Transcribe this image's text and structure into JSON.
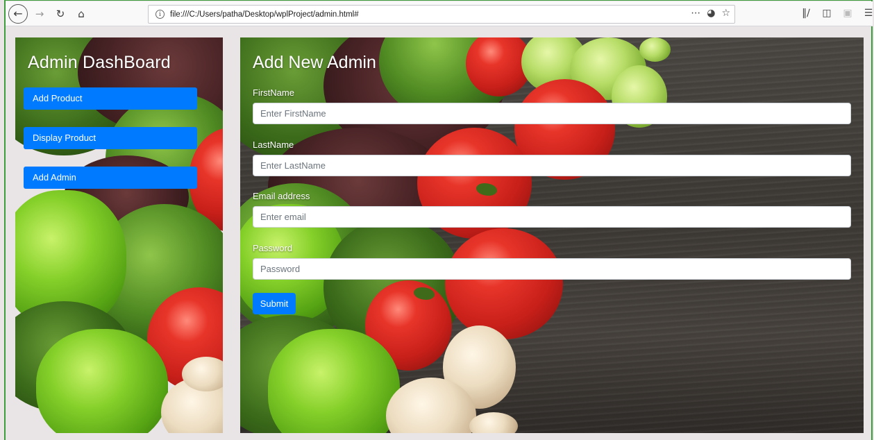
{
  "browser": {
    "url": "file:///C:/Users/patha/Desktop/wplProject/admin.html#",
    "icons": {
      "back": "back-arrow-icon",
      "forward": "forward-arrow-icon",
      "reload": "reload-icon",
      "home": "home-icon",
      "info": "info-icon",
      "page_actions": "more-dots-icon",
      "pocket": "pocket-icon",
      "bookmark": "star-icon",
      "library": "library-icon",
      "sidebar": "sidebar-icon",
      "reader": "reader-icon",
      "menu": "hamburger-menu-icon"
    }
  },
  "sidebar": {
    "title": "Admin DashBoard",
    "items": [
      {
        "label": "Add Product"
      },
      {
        "label": "Display Product"
      },
      {
        "label": "Add Admin"
      }
    ]
  },
  "form": {
    "title": "Add New Admin",
    "fields": [
      {
        "label": "FirstName",
        "placeholder": "Enter FirstName",
        "value": ""
      },
      {
        "label": "LastName",
        "placeholder": "Enter LastName",
        "value": ""
      },
      {
        "label": "Email address",
        "placeholder": "Enter email",
        "value": ""
      },
      {
        "label": "Password",
        "placeholder": "Password",
        "value": ""
      }
    ],
    "submit_label": "Submit"
  },
  "colors": {
    "primary_button": "#007bff",
    "page_background": "#e9e5e6",
    "wood": "#3d3935"
  }
}
